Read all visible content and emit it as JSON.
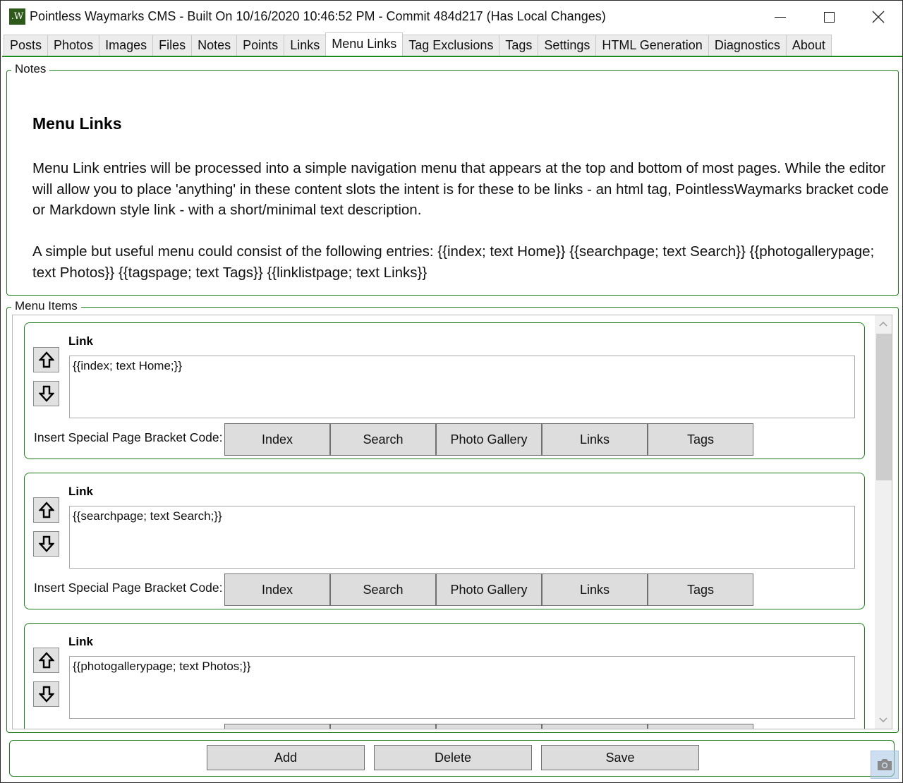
{
  "window": {
    "title": "Pointless Waymarks CMS - Built On 10/16/2020 10:46:52 PM - Commit 484d217 (Has Local Changes)",
    "app_icon_text": ".W",
    "controls": {
      "minimize": "minimize",
      "maximize": "maximize",
      "close": "close"
    }
  },
  "tabs": [
    {
      "label": "Posts"
    },
    {
      "label": "Photos"
    },
    {
      "label": "Images"
    },
    {
      "label": "Files"
    },
    {
      "label": "Notes"
    },
    {
      "label": "Points"
    },
    {
      "label": "Links"
    },
    {
      "label": "Menu Links",
      "active": true
    },
    {
      "label": "Tag Exclusions"
    },
    {
      "label": "Tags"
    },
    {
      "label": "Settings"
    },
    {
      "label": "HTML Generation"
    },
    {
      "label": "Diagnostics"
    },
    {
      "label": "About"
    }
  ],
  "notes": {
    "legend": "Notes",
    "heading": "Menu Links",
    "paragraph1": "Menu Link entries will be processed into a simple navigation menu that appears at the top and bottom of most pages. While the editor will allow you to place 'anything' in these content slots the intent is for these to be links - an html  tag, PointlessWaymarks bracket code or Markdown style link - with a short/minimal text description.",
    "paragraph2": "A simple but useful menu could consist of the following entries: {{index; text Home}} {{searchpage; text Search}} {{photogallerypage; text Photos}} {{tagspage; text Tags}} {{linklistpage; text Links}}"
  },
  "menu_items": {
    "legend": "Menu Items",
    "link_label": "Link",
    "insert_label": "Insert Special Page Bracket Code:",
    "code_buttons": [
      "Index",
      "Search",
      "Photo Gallery",
      "Links",
      "Tags"
    ],
    "items": [
      {
        "value": "{{index; text Home;}}"
      },
      {
        "value": "{{searchpage; text Search;}}"
      },
      {
        "value": "{{photogallerypage; text Photos;}}"
      }
    ]
  },
  "actions": {
    "add": "Add",
    "delete": "Delete",
    "save": "Save"
  }
}
